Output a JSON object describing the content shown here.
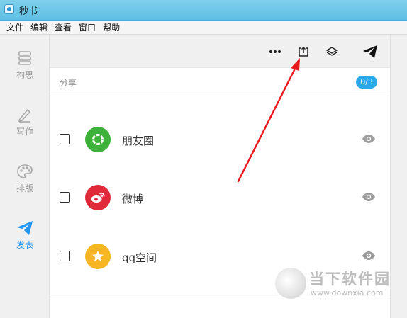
{
  "window": {
    "title": "秒书"
  },
  "menu": [
    "文件",
    "编辑",
    "查看",
    "窗口",
    "帮助"
  ],
  "sidebar": {
    "items": [
      {
        "label": "构思",
        "icon": "outline-icon",
        "active": false
      },
      {
        "label": "写作",
        "icon": "pen-icon",
        "active": false
      },
      {
        "label": "排版",
        "icon": "palette-icon",
        "active": false
      },
      {
        "label": "发表",
        "icon": "paper-plane-icon",
        "active": true
      }
    ]
  },
  "toolbar": {
    "buttons": [
      "more-icon",
      "export-icon",
      "layers-icon",
      "send-icon"
    ]
  },
  "share": {
    "title": "分享",
    "count": "0/3",
    "platforms": [
      {
        "name": "朋友圈",
        "color": "#3db13a",
        "icon": "moments-icon",
        "checked": false
      },
      {
        "name": "微博",
        "color": "#e02a3a",
        "icon": "weibo-icon",
        "checked": false
      },
      {
        "name": "qq空间",
        "color": "#f6b623",
        "icon": "qzone-star-icon",
        "checked": false
      }
    ]
  },
  "colors": {
    "accent": "#2196f3",
    "badge": "#29a8ea",
    "arrow": "#e8191f"
  },
  "watermark": {
    "text": "当下软件园",
    "url": "www.downxia.com"
  }
}
